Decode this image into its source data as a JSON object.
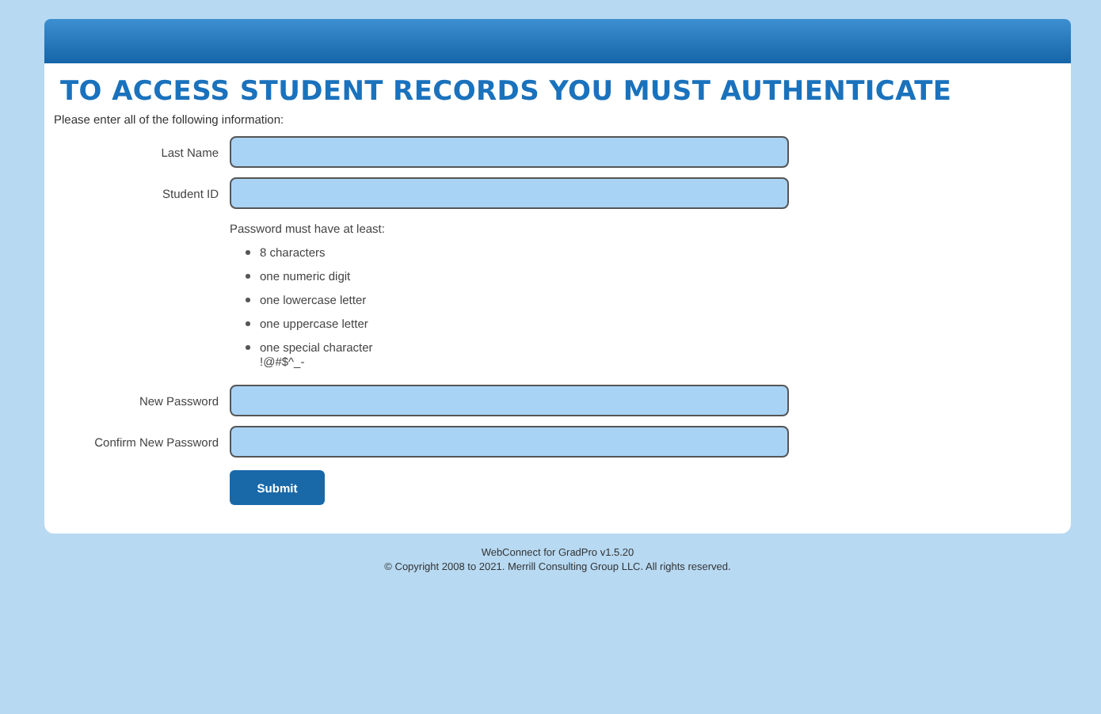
{
  "title": "TO ACCESS STUDENT RECORDS YOU MUST AUTHENTICATE",
  "intro": "Please enter all of the following information:",
  "fields_top": [
    {
      "label": "Last Name"
    },
    {
      "label": "Student ID"
    }
  ],
  "password_rules": {
    "heading": "Password must have at least:",
    "items": [
      "8 characters",
      "one numeric digit",
      "one lowercase letter",
      "one uppercase letter",
      "one special character !@#$^_-"
    ]
  },
  "fields_bottom": [
    {
      "label": "New Password"
    },
    {
      "label": "Confirm New Password"
    }
  ],
  "submit": "Submit",
  "footer": [
    "WebConnect for GradPro v1.5.20",
    "© Copyright 2008 to 2021. Merrill Consulting Group LLC. All rights reserved."
  ]
}
